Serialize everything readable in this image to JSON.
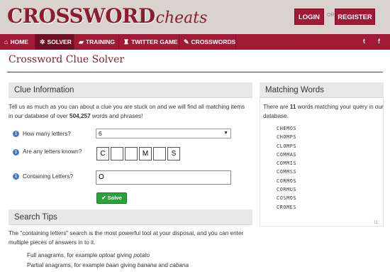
{
  "header": {
    "logo_main": "CROSSWORD",
    "logo_script": "cheats",
    "login_label": "LOGIN",
    "or_label": "OR",
    "register_label": "REGISTER"
  },
  "nav": {
    "items": [
      {
        "label": "HOME",
        "icon": "home-icon",
        "glyph": "⌂"
      },
      {
        "label": "SOLVER",
        "icon": "gear-icon",
        "glyph": "✲"
      },
      {
        "label": "TRAINING",
        "icon": "graduation-cap-icon",
        "glyph": "▰"
      },
      {
        "label": "TWITTER GAME",
        "icon": "trophy-icon",
        "glyph": "♜"
      },
      {
        "label": "CROSSWORDS",
        "icon": "pencil-icon",
        "glyph": "✎"
      }
    ],
    "twitter_glyph": "t",
    "facebook_glyph": "f"
  },
  "page": {
    "title": "Crossword Clue Solver"
  },
  "clue_info": {
    "heading": "Clue Information",
    "intro_pre": "Tell us as much as you can about a clue you are stuck on and we will find all matching items in our database of over ",
    "intro_count": "504,257",
    "intro_post": " words and phrases!",
    "info_glyph": "i",
    "letters_label": "How many letters?",
    "letters_value": "6",
    "known_label": "Are any letters known?",
    "known_letters": [
      "C",
      "",
      "",
      "M",
      "",
      "S"
    ],
    "containing_label": "Containing Letters?",
    "containing_value": "O",
    "solve_label": "Solve",
    "solve_glyph": "✔"
  },
  "search_tips": {
    "heading": "Search Tips",
    "text": "The \"containing letters\" search is the most powerful tool at your disposal, and you can enter multiple pieces of answers in to it.",
    "full_pre": "Full anagrams, for example ",
    "full_ex1": "optoat",
    "full_mid": " giving ",
    "full_ex2": "potato",
    "partial_pre": "Partial anagrams, for example ",
    "partial_ex1": "baan",
    "partial_mid": " giving ",
    "partial_ex2": "banana",
    "partial_and": " and ",
    "partial_ex3": "cabana"
  },
  "matching": {
    "heading": "Matching Words",
    "pre": "There are ",
    "count": "11",
    "post": " words matching your query in our database.",
    "words": [
      "CHEMOS",
      "CHOMPS",
      "CLOMPS",
      "COMMAS",
      "COMMIS",
      "COMMSS",
      "CORMOS",
      "CORMUS",
      "COSMOS",
      "CROMES"
    ],
    "scroll_label": "11"
  },
  "colors": {
    "brand": "#a01937",
    "accent_dark": "#6e0f24",
    "solve_green": "#2aa33b",
    "info_blue": "#4a78c2"
  }
}
